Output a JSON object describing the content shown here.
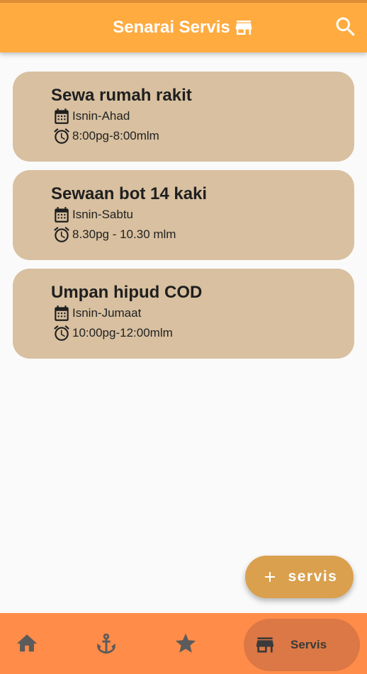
{
  "appbar": {
    "title": "Senarai Servis",
    "title_icon": "store-icon",
    "search_icon": "search-icon"
  },
  "services": [
    {
      "name": "Sewa rumah rakit",
      "days": "Isnin-Ahad",
      "hours": "8:00pg-8:00mlm"
    },
    {
      "name": "Sewaan bot 14 kaki",
      "days": "Isnin-Sabtu",
      "hours": "8.30pg - 10.30 mlm"
    },
    {
      "name": "Umpan hipud COD",
      "days": "Isnin-Jumaat",
      "hours": "10:00pg-12:00mlm"
    }
  ],
  "fab": {
    "label": "servis",
    "icon": "plus-icon"
  },
  "bottom_nav": {
    "items": [
      {
        "icon": "home-icon"
      },
      {
        "icon": "anchor-icon"
      },
      {
        "icon": "star-icon"
      },
      {
        "icon": "store-icon",
        "label": "Servis",
        "active": true
      }
    ]
  },
  "colors": {
    "appbar": "#ffab40",
    "card": "#d8c0a0",
    "fab": "#daa04e",
    "bottom_nav": "#ff8c48",
    "nav_active": "#db7845"
  }
}
